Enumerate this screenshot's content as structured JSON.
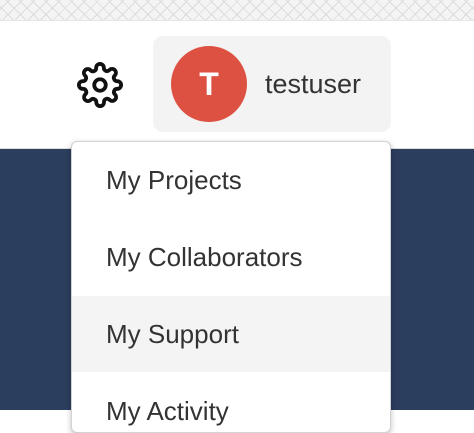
{
  "header": {
    "settings_icon": "gear-icon",
    "user": {
      "avatar_initial": "T",
      "avatar_color": "#dd5142",
      "username": "testuser"
    }
  },
  "dropdown": {
    "items": [
      {
        "label": "My Projects"
      },
      {
        "label": "My Collaborators"
      },
      {
        "label": "My Support",
        "highlighted": true
      },
      {
        "label": "My Activity"
      }
    ]
  },
  "colors": {
    "page_background": "#2b3e5e",
    "highlight": "#f4f4f4"
  }
}
